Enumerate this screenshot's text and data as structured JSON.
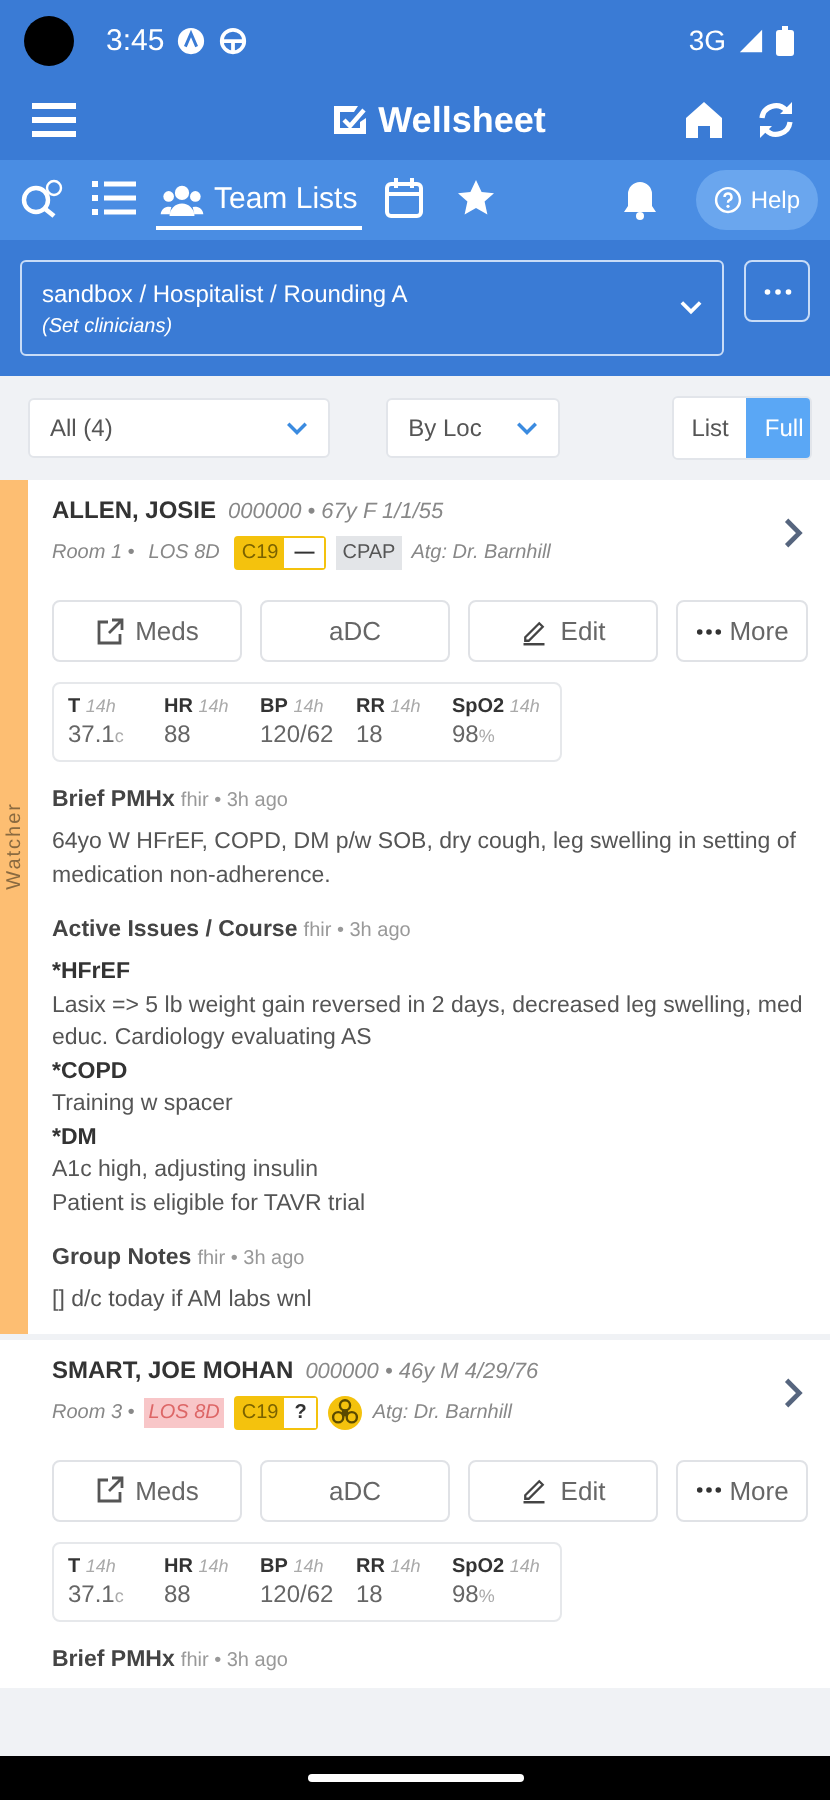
{
  "status_bar": {
    "time": "3:45",
    "network": "3G"
  },
  "header": {
    "title": "Wellsheet"
  },
  "nav": {
    "items": [
      {
        "kind": "search",
        "selected": false
      },
      {
        "kind": "list",
        "selected": false
      },
      {
        "kind": "team",
        "label": "Team Lists",
        "selected": true
      },
      {
        "kind": "calendar",
        "selected": false
      },
      {
        "kind": "star",
        "selected": false
      }
    ],
    "help": "Help"
  },
  "list_selector": {
    "title": "sandbox / Hospitalist / Rounding A",
    "subtitle": "(Set clinicians)"
  },
  "filters": {
    "group": "All (4)",
    "sort": "By Loc",
    "view_modes": [
      {
        "label": "List",
        "selected": false
      },
      {
        "label": "Full",
        "selected": true
      }
    ]
  },
  "patients": [
    {
      "name": "ALLEN, JOSIE",
      "demographics": "000000 • 67y F 1/1/55",
      "room": "Room 1 •",
      "los": "LOS 8D",
      "los_alert": false,
      "c19": "C19",
      "c19_status": "—",
      "tag": "CPAP",
      "hazard": false,
      "attending": "Atg: Dr. Barnhill",
      "watcher": "Watcher",
      "actions": [
        {
          "kind": "external",
          "label": "Meds"
        },
        {
          "kind": "plain",
          "label": "aDC"
        },
        {
          "kind": "edit",
          "label": "Edit"
        },
        {
          "kind": "more",
          "label": "More"
        }
      ],
      "vitals": [
        {
          "label": "T",
          "age": "14h",
          "value": "37.1",
          "unit": "c"
        },
        {
          "label": "HR",
          "age": "14h",
          "value": "88"
        },
        {
          "label": "BP",
          "age": "14h",
          "value": "120/62"
        },
        {
          "label": "RR",
          "age": "14h",
          "value": "18"
        },
        {
          "label": "SpO2",
          "age": "14h",
          "value": "98",
          "unit": "%"
        }
      ],
      "sections": [
        {
          "title": "Brief PMHx",
          "meta": "fhir • 3h ago",
          "lines": [
            {
              "text": "64yo W HFrEF, COPD, DM p/w SOB, dry cough, leg swelling in setting of medication non-adherence.",
              "bold": false
            }
          ]
        },
        {
          "title": "Active Issues / Course",
          "meta": "fhir • 3h ago",
          "lines": [
            {
              "text": "*HFrEF",
              "bold": true
            },
            {
              "text": "Lasix => 5 lb weight gain reversed in 2 days, decreased leg swelling, med educ. Cardiology evaluating AS",
              "bold": false
            },
            {
              "text": "*COPD",
              "bold": true
            },
            {
              "text": "Training w spacer",
              "bold": false
            },
            {
              "text": "*DM",
              "bold": true
            },
            {
              "text": "A1c high, adjusting insulin",
              "bold": false
            },
            {
              "text": "Patient is eligible for TAVR trial",
              "bold": false
            }
          ]
        },
        {
          "title": "Group Notes",
          "meta": "fhir • 3h ago",
          "lines": [
            {
              "text": "[] d/c today if AM labs wnl",
              "bold": false
            }
          ]
        }
      ]
    },
    {
      "name": "SMART, JOE MOHAN",
      "demographics": "000000 • 46y M 4/29/76",
      "room": "Room 3 •",
      "los": "LOS 8D",
      "los_alert": true,
      "c19": "C19",
      "c19_status": "?",
      "hazard": true,
      "attending": "Atg: Dr. Barnhill",
      "actions": [
        {
          "kind": "external",
          "label": "Meds"
        },
        {
          "kind": "plain",
          "label": "aDC"
        },
        {
          "kind": "edit",
          "label": "Edit"
        },
        {
          "kind": "more",
          "label": "More"
        }
      ],
      "vitals": [
        {
          "label": "T",
          "age": "14h",
          "value": "37.1",
          "unit": "c"
        },
        {
          "label": "HR",
          "age": "14h",
          "value": "88"
        },
        {
          "label": "BP",
          "age": "14h",
          "value": "120/62"
        },
        {
          "label": "RR",
          "age": "14h",
          "value": "18"
        },
        {
          "label": "SpO2",
          "age": "14h",
          "value": "98",
          "unit": "%"
        }
      ],
      "sections": [
        {
          "title": "Brief PMHx",
          "meta": "fhir • 3h ago"
        }
      ]
    }
  ]
}
